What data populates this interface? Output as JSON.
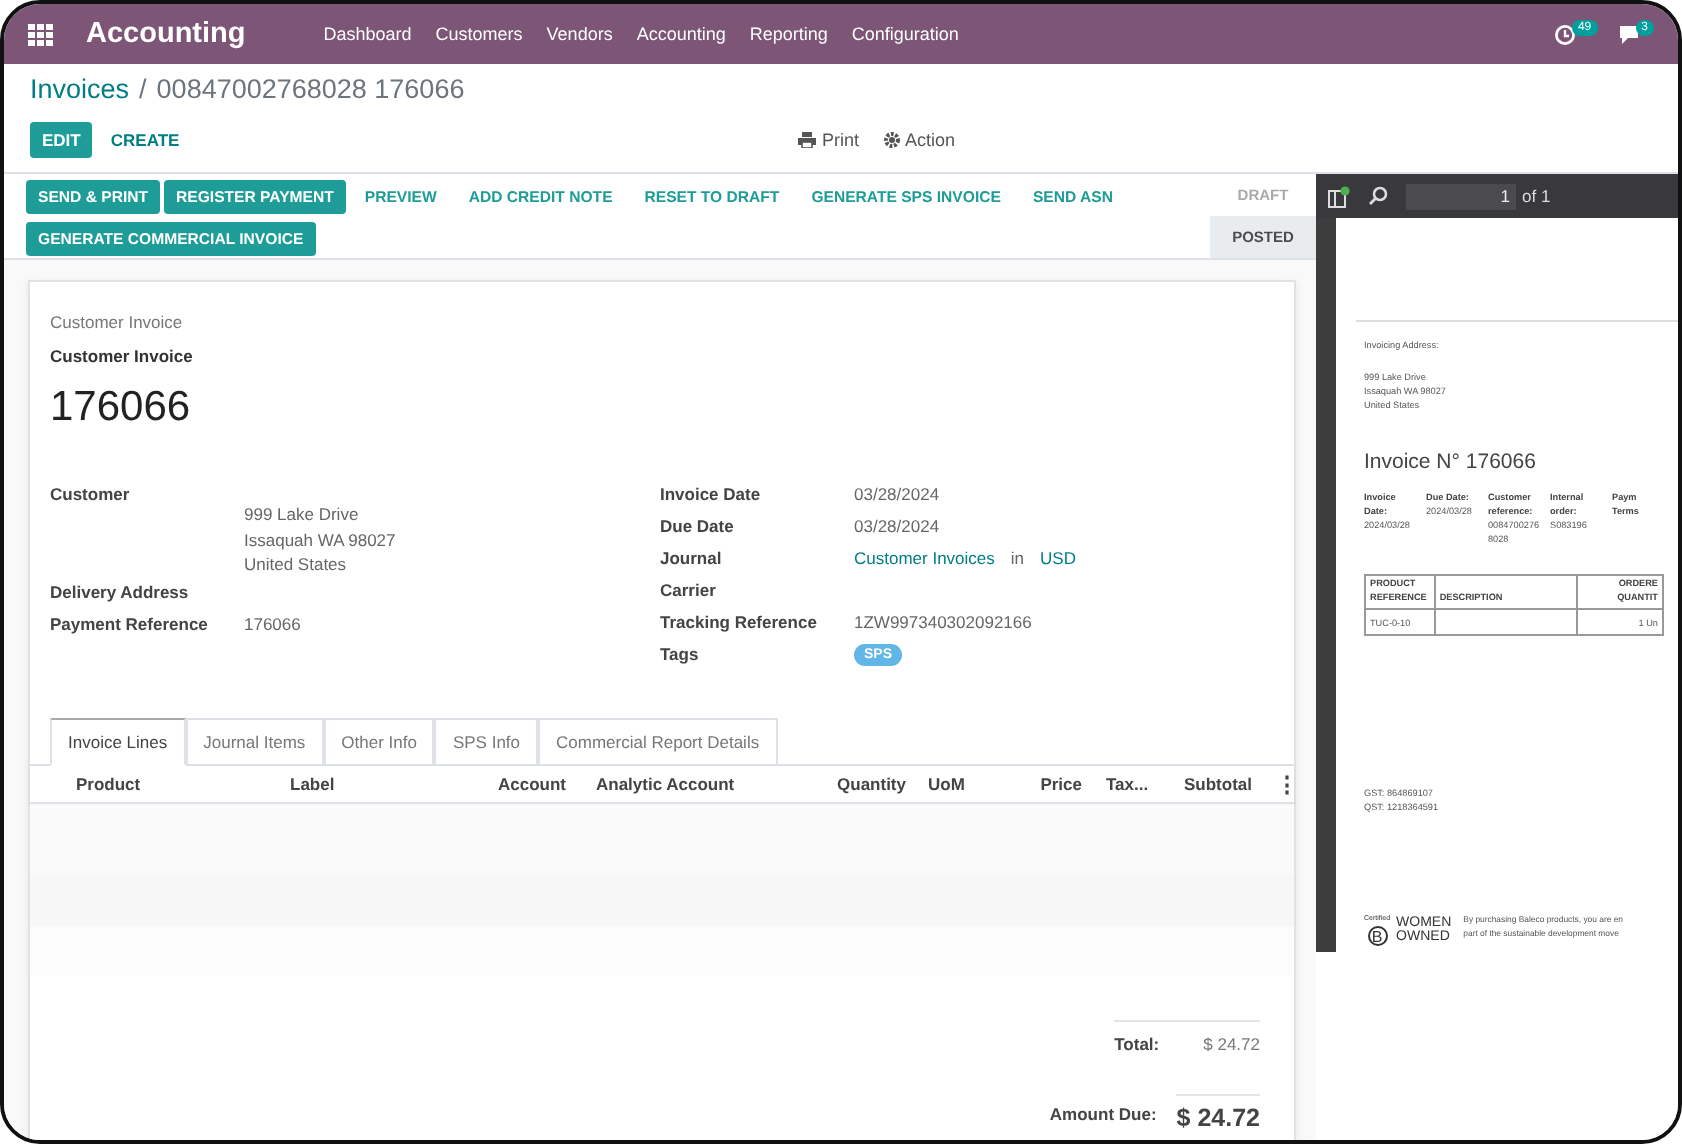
{
  "app": {
    "title": "Accounting",
    "menu": [
      "Dashboard",
      "Customers",
      "Vendors",
      "Accounting",
      "Reporting",
      "Configuration"
    ],
    "badges": [
      {
        "kind": "activity",
        "count": "49"
      },
      {
        "kind": "messages",
        "count": "3"
      }
    ]
  },
  "breadcrumb": {
    "parent": "Invoices",
    "separator": "/",
    "current": "00847002768028 176066"
  },
  "actions": {
    "buttons": [
      {
        "label": "EDIT",
        "kind": "primary"
      },
      {
        "label": "CREATE",
        "kind": "link"
      }
    ],
    "print": "Print",
    "action": "Action"
  },
  "statusbar": {
    "buttons": [
      {
        "label": "SEND & PRINT",
        "kind": "primary"
      },
      {
        "label": "REGISTER PAYMENT",
        "kind": "primary"
      },
      {
        "label": "PREVIEW",
        "kind": "link"
      },
      {
        "label": "ADD CREDIT NOTE",
        "kind": "link"
      },
      {
        "label": "RESET TO DRAFT",
        "kind": "link"
      },
      {
        "label": "GENERATE SPS INVOICE",
        "kind": "link"
      },
      {
        "label": "SEND ASN",
        "kind": "link"
      },
      {
        "label": "GENERATE COMMERCIAL INVOICE",
        "kind": "primary"
      }
    ],
    "stages": [
      {
        "label": "DRAFT",
        "selected": false
      },
      {
        "label": "POSTED",
        "selected": true
      }
    ]
  },
  "sheet": {
    "type_label": "Customer Invoice",
    "type_title": "Customer Invoice",
    "number": "176066",
    "left_fields": [
      {
        "label": "Customer",
        "kind": "address",
        "lines": [
          "999 Lake Drive",
          "Issaquah WA 98027",
          "United States"
        ]
      },
      {
        "label": "Delivery Address",
        "kind": "text"
      },
      {
        "label": "Payment Reference",
        "kind": "text",
        "value": "176066"
      }
    ],
    "right_fields": [
      {
        "label": "Invoice Date",
        "kind": "text",
        "value": "03/28/2024"
      },
      {
        "label": "Due Date",
        "kind": "text",
        "value": "03/28/2024"
      },
      {
        "label": "Journal",
        "kind": "links",
        "links": [
          "Customer Invoices",
          "USD"
        ],
        "joiner": "in"
      },
      {
        "label": "Carrier",
        "kind": "text"
      },
      {
        "label": "Tracking Reference",
        "kind": "text",
        "value": "1ZW997340302092166"
      },
      {
        "label": "Tags",
        "kind": "tags",
        "tags": [
          "SPS"
        ]
      }
    ],
    "tabs": [
      {
        "label": "Invoice Lines",
        "selected": true
      },
      {
        "label": "Journal Items",
        "selected": false
      },
      {
        "label": "Other Info",
        "selected": false
      },
      {
        "label": "SPS Info",
        "selected": false
      },
      {
        "label": "Commercial Report Details",
        "selected": false
      }
    ],
    "table": {
      "columns": [
        "Product",
        "Label",
        "Account",
        "Analytic Account",
        "Quantity",
        "UoM",
        "Price",
        "Tax...",
        "Subtotal"
      ],
      "menu": "⋮"
    },
    "totals": [
      {
        "label": "Total:",
        "value": "$ 24.72",
        "kind": "normal"
      },
      {
        "label": "Amount Due:",
        "value": "$ 24.72",
        "kind": "strong"
      }
    ]
  },
  "pdf": {
    "page": "1",
    "of": "of 1",
    "document": {
      "address_title": "Invoicing Address:",
      "address": [
        "999 Lake Drive",
        "Issaquah WA 98027",
        "United States"
      ],
      "title": "Invoice N° 176066",
      "info": [
        {
          "label": "Invoice Date:",
          "value": "2024/03/28"
        },
        {
          "label": "Due Date:",
          "value": "2024/03/28"
        },
        {
          "label": "Customer reference:",
          "value": "00847002768028"
        },
        {
          "label": "Internal order:",
          "value": "S083196"
        },
        {
          "label": "Paym Terms"
        }
      ],
      "table_headers": [
        "PRODUCT REFERENCE",
        "DESCRIPTION",
        "ORDERE QUANTIT"
      ],
      "table_row": {
        "reference": "TUC-0-10",
        "quantity": "1 Un"
      },
      "tax_ids": [
        "GST: 864869107",
        "QST: 1218364591"
      ],
      "logo": [
        "Certified",
        "B",
        "WOMEN",
        "OWNED"
      ],
      "footer": [
        "By purchasing Baleco products, you are en",
        "part of the sustainable development move"
      ]
    }
  }
}
